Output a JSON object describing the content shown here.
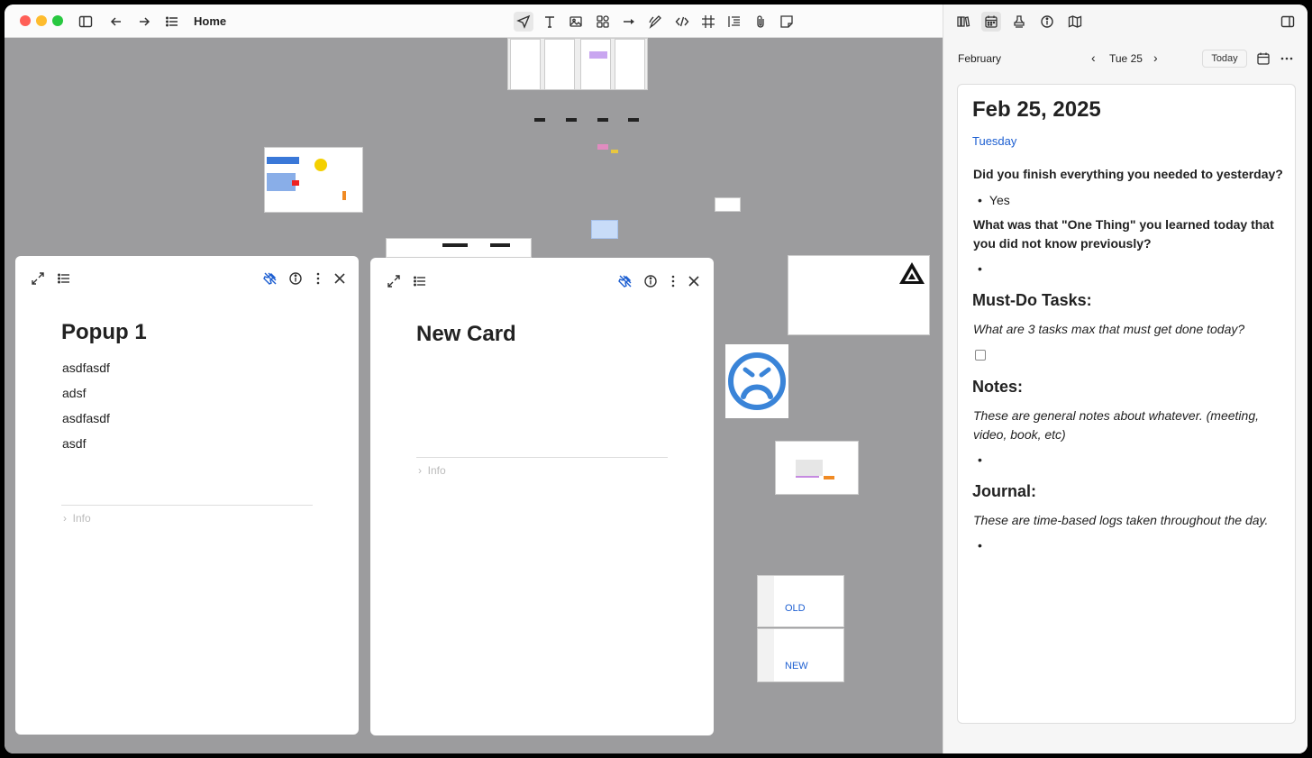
{
  "titlebar": {
    "title": "Home",
    "icons": [
      "sidebar-toggle-icon",
      "back-arrow-icon",
      "forward-arrow-icon",
      "list-icon",
      "cursor-icon",
      "text-tool-icon",
      "image-tool-icon",
      "shapes-tool-icon",
      "arrow-tool-icon",
      "pen-tool-icon",
      "code-tool-icon",
      "frame-tool-icon",
      "outline-tool-icon",
      "attachment-icon",
      "sticky-note-icon"
    ]
  },
  "canvas": {
    "thumb_labels": {
      "old": "OLD",
      "new": "NEW"
    }
  },
  "cards": [
    {
      "title": "Popup 1",
      "lines": [
        "asdfasdf",
        "adsf",
        "asdfasdf",
        "asdf"
      ],
      "info_label": "Info"
    },
    {
      "title": "New Card",
      "lines": [],
      "info_label": "Info"
    }
  ],
  "sidepanel": {
    "month": "February",
    "date": "Tue 25",
    "today_label": "Today",
    "daily": {
      "title": "Feb 25, 2025",
      "weekday": "Tuesday",
      "q1": "Did you finish everything you needed to yesterday?",
      "a1": "Yes",
      "q2": "What was that \"One Thing\" you learned today that you did not know previously?",
      "h_tasks": "Must-Do Tasks:",
      "tasks_prompt": "What are 3 tasks max that must get done today?",
      "h_notes": "Notes:",
      "notes_prompt": "These are general notes about whatever. (meeting, video, book, etc)",
      "h_journal": "Journal:",
      "journal_prompt": "These are time-based logs taken throughout the day."
    }
  },
  "colors": {
    "accent": "#1d5fd1",
    "canvas": "#9c9c9e",
    "close": "#ff5f57",
    "minimize": "#febc2e",
    "zoom": "#28c840"
  }
}
